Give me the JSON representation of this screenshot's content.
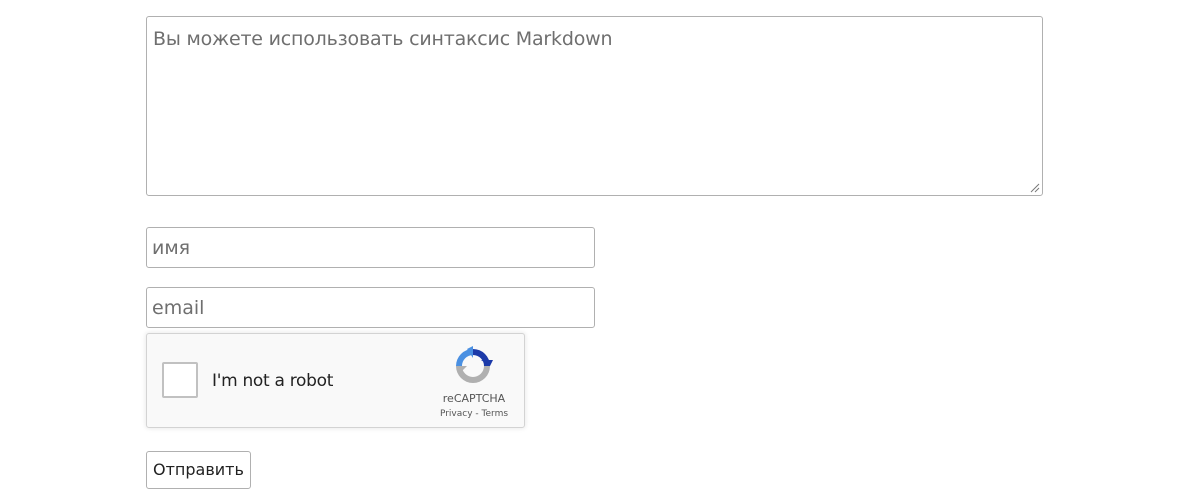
{
  "comment": {
    "placeholder": "Вы можете использовать синтаксис Markdown",
    "value": ""
  },
  "name_field": {
    "placeholder": "имя",
    "value": ""
  },
  "email_field": {
    "placeholder": "email",
    "value": ""
  },
  "recaptcha": {
    "label": "I'm not a robot",
    "brand": "reCAPTCHA",
    "privacy_link": "Privacy",
    "separator": " - ",
    "terms_link": "Terms",
    "checked": false,
    "colors": {
      "blue": "#1c3aa9",
      "light_blue": "#4a90e2",
      "gray": "#b0b0b0"
    }
  },
  "submit": {
    "label": "Отправить"
  }
}
